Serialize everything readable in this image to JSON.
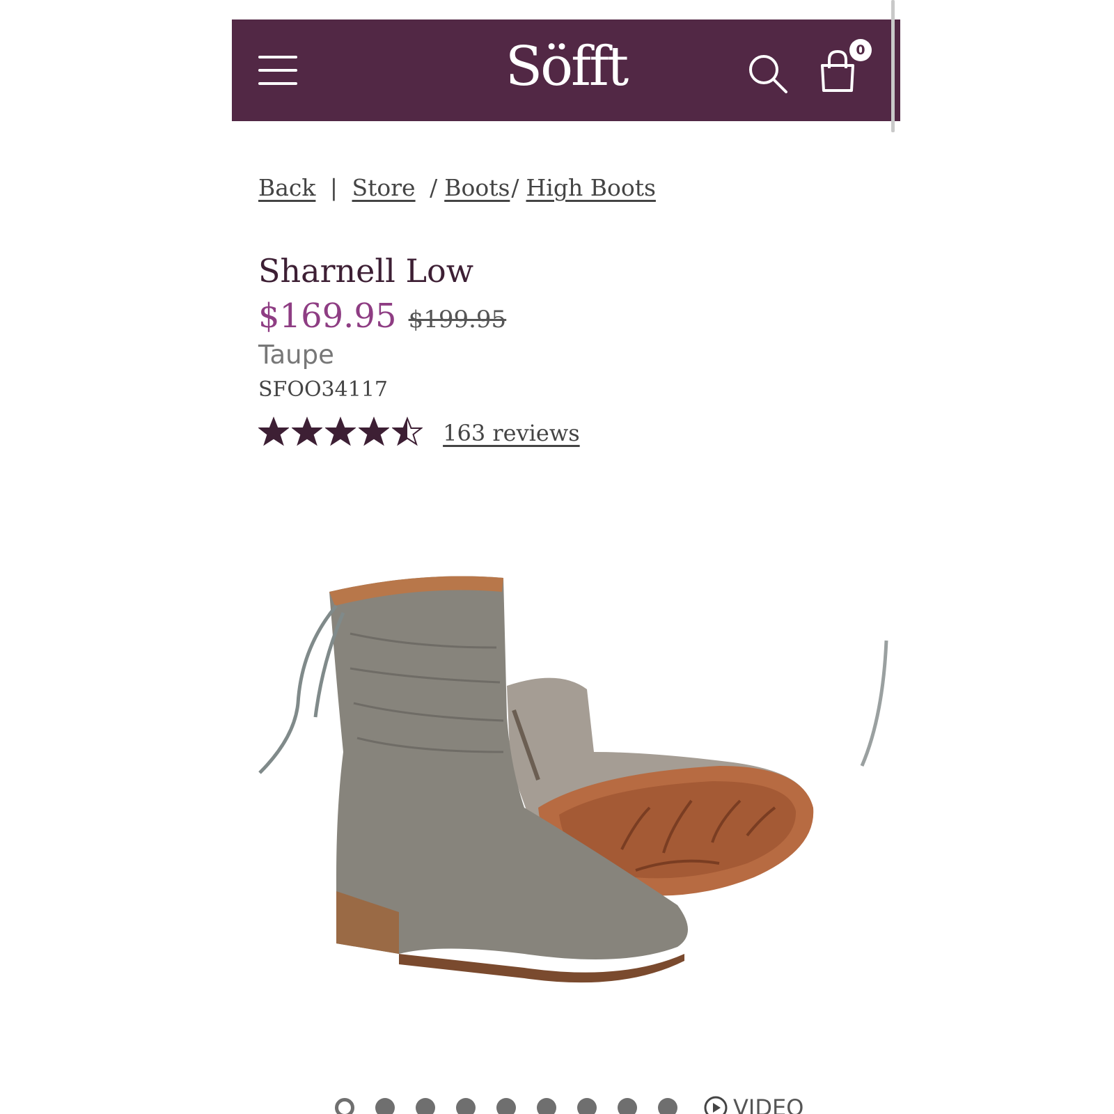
{
  "header": {
    "logo_text": "Söfft",
    "cart_count": "0",
    "bg_color": "#522845"
  },
  "breadcrumb": {
    "back": "Back",
    "divider": "|",
    "store": "Store",
    "sep1": "/",
    "boots": "Boots",
    "sep2": "/",
    "high_boots": "High Boots"
  },
  "product": {
    "title": "Sharnell Low",
    "sale_price": "$169.95",
    "original_price": "$199.95",
    "color": "Taupe",
    "sku": "SFOO34117",
    "rating": 4.5,
    "rating_max": 5,
    "reviews_label": "163 reviews",
    "accent_color": "#8e3d83"
  },
  "gallery": {
    "image_alt_icon": "boot-product-image",
    "dot_count": 9,
    "active_dot": 1,
    "video_label": "VIDEO"
  },
  "icons": {
    "menu": "hamburger-icon",
    "search": "search-icon",
    "cart": "shopping-bag-icon",
    "star": "star-icon",
    "play": "play-icon"
  }
}
